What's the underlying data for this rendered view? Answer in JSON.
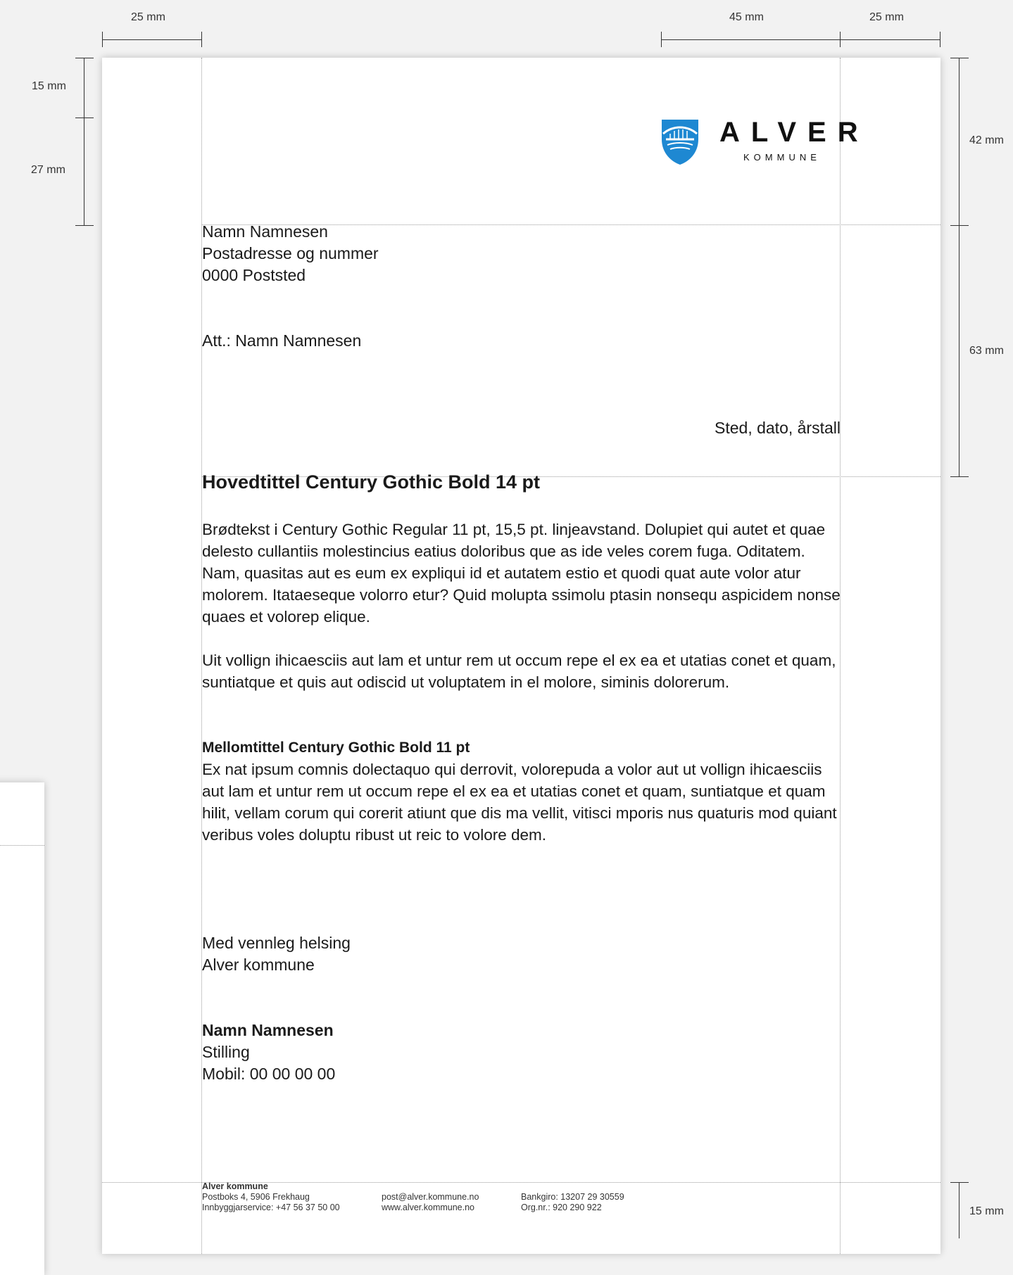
{
  "dimensions": {
    "left_margin": "25 mm",
    "right_column": "45 mm",
    "right_margin": "25 mm",
    "top_margin": "15 mm",
    "logo_area": "27 mm",
    "header_total": "42 mm",
    "address_block": "63 mm",
    "footer_margin": "15 mm"
  },
  "logo": {
    "name": "ALVER",
    "sub": "KOMMUNE",
    "shield_color": "#1e88d2"
  },
  "recipient": {
    "name": "Namn Namnesen",
    "address": "Postadresse og nummer",
    "postal": "0000 Poststed",
    "att": "Att.: Namn Namnesen"
  },
  "date_line": "Sted, dato, årstall",
  "content": {
    "title": "Hovedtittel Century Gothic Bold 14 pt",
    "paragraph1": "Brødtekst i Century Gothic Regular 11 pt, 15,5 pt. linjeavstand. Dolupiet qui autet et quae delesto cullantiis molestincius eatius doloribus que as ide veles corem fuga. Oditatem. Nam, quasitas aut es eum ex expliqui id et autatem estio et quodi quat aute volor atur molorem. Itataeseque volorro etur? Quid molupta ssimolu ptasin nonsequ aspicidem nonse quaes et volorep elique.",
    "paragraph2": "Uit vollign ihicaesciis aut lam et untur rem ut occum repe el ex ea et utatias conet et quam, suntiatque et quis aut odiscid ut voluptatem in el molore, siminis dolorerum.",
    "subtitle": "Mellomtittel Century Gothic Bold 11 pt",
    "paragraph3": "Ex nat ipsum comnis dolectaquo qui derrovit, volorepuda a volor aut ut vollign ihicaesciis aut lam et untur rem ut occum repe el ex ea et utatias conet et quam, suntiatque et quam hilit, vellam corum qui corerit atiunt que dis ma vellit, vitisci mporis nus quaturis mod quiant veribus voles doluptu ribust ut reic to volore dem."
  },
  "closing": {
    "greeting": "Med vennleg helsing",
    "org": "Alver kommune"
  },
  "signature": {
    "name": "Namn Namnesen",
    "title": "Stilling",
    "mobile": "Mobil: 00 00 00 00"
  },
  "footer": {
    "org_name": "Alver kommune",
    "postbox": "Postboks 4, 5906 Frekhaug",
    "service": "Innbyggjarservice: +47 56 37 50 00",
    "email": "post@alver.kommune.no",
    "web": "www.alver.kommune.no",
    "bank": "Bankgiro: 13207 29 30559",
    "orgnr": "Org.nr.: 920 290 922"
  }
}
